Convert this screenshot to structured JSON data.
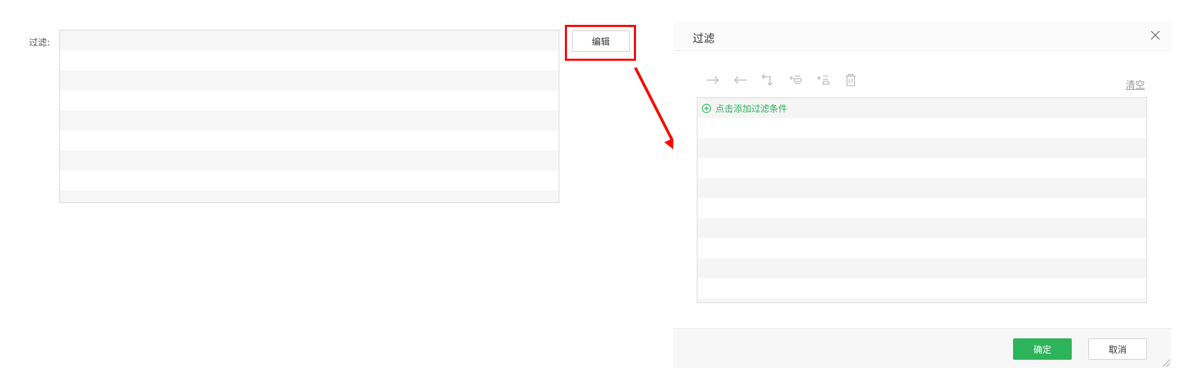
{
  "filter": {
    "label": "过滤:",
    "row_count": 8
  },
  "edit_button": {
    "label": "编辑"
  },
  "dialog": {
    "title": "过滤",
    "toolbar_icons": [
      "indent-right-icon",
      "indent-left-icon",
      "return-icon",
      "add-condition-icon",
      "add-subcondition-icon",
      "delete-icon"
    ],
    "clear_label": "清空",
    "add_condition_label": "点击添加过滤条件",
    "condition_row_count": 10,
    "ok_label": "确定",
    "cancel_label": "取消"
  },
  "colors": {
    "accent_green": "#2db45a",
    "highlight_red": "#ff0000",
    "stripe_gray": "#f6f6f6"
  }
}
